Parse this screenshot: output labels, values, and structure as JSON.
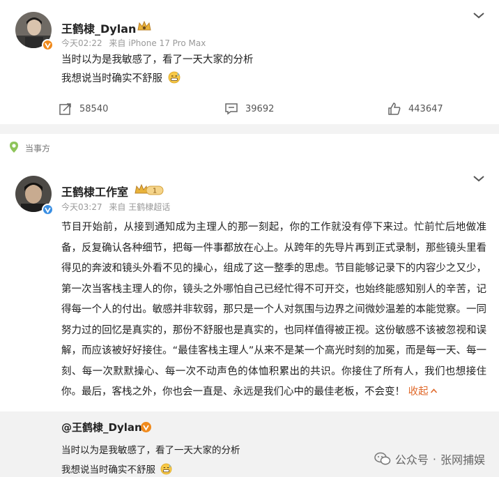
{
  "post1": {
    "author": "王鹤棣_Dylan",
    "timestamp": "今天02:22",
    "source": "来自 iPhone 17 Pro Max",
    "lines": [
      "当时以为是我敏感了，看了一天大家的分析",
      "我想说当时确实不舒服"
    ],
    "emoji": "sweat-smile-emoji",
    "reposts": "58540",
    "comments": "39692",
    "likes": "443647"
  },
  "party_label": "当事方",
  "post2": {
    "author": "王鹤棣工作室",
    "level": "1",
    "timestamp": "今天03:27",
    "source": "来自 王鹤棣超话",
    "body": "节目开始前，从接到通知成为主理人的那一刻起，你的工作就没有停下来过。忙前忙后地做准备，反复确认各种细节，把每一件事都放在心上。从跨年的先导片再到正式录制，那些镜头里看得见的奔波和镜头外看不见的操心，组成了这一整季的思虑。节目能够记录下的内容少之又少，第一次当客栈主理人的你，镜头之外哪怕自己已经忙得不可开交，也始终能感知别人的辛苦，记得每一个人的付出。敏感并非软弱，那只是一个人对氛围与边界之间微妙温差的本能觉察。一同努力过的回忆是真实的，那份不舒服也是真实的，也同样值得被正视。这份敏感不该被忽视和误解，而应该被好好接住。“最佳客栈主理人”从来不是某一个高光时刻的加冕，而是每一天、每一刻、每一次默默操心、每一次不动声色的体恤积累出的共识。你接住了所有人，我们也想接住你。最后，客栈之外，你也会一直是、永远是我们心中的最佳老板，不会变！",
    "collapse": "收起"
  },
  "quoted": {
    "author": "@王鹤棣_Dylan",
    "lines": [
      "当时以为是我敏感了，看了一天大家的分析",
      "我想说当时确实不舒服"
    ]
  },
  "watermark": {
    "prefix": "公众号",
    "dot": "·",
    "name": "张网捕娱"
  },
  "colors": {
    "accent_orange": "#e06a2c",
    "verified_orange": "#f08a1c",
    "verified_blue": "#3a8fe3",
    "separator": "#f3f3f3",
    "quote_bg": "#f2f2f2"
  }
}
